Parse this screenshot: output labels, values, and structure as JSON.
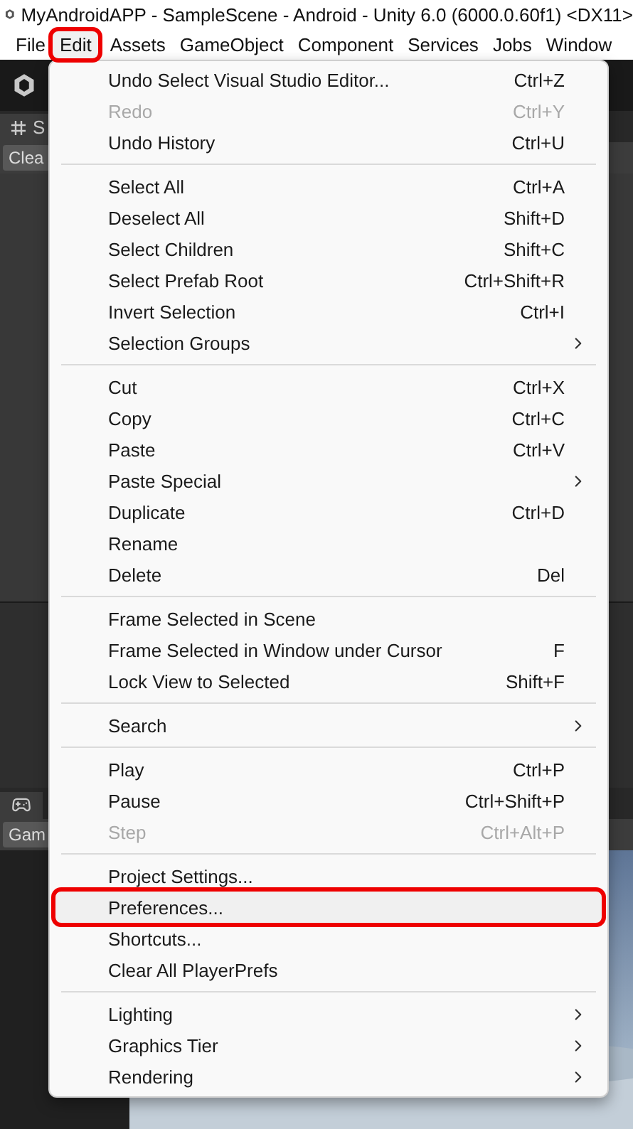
{
  "window": {
    "title": "MyAndroidAPP - SampleScene - Android - Unity 6.0 (6000.0.60f1) <DX11>"
  },
  "menubar": [
    {
      "label": "File",
      "selected": false
    },
    {
      "label": "Edit",
      "selected": true
    },
    {
      "label": "Assets",
      "selected": false
    },
    {
      "label": "GameObject",
      "selected": false
    },
    {
      "label": "Component",
      "selected": false
    },
    {
      "label": "Services",
      "selected": false
    },
    {
      "label": "Jobs",
      "selected": false
    },
    {
      "label": "Window",
      "selected": false
    }
  ],
  "editor": {
    "scene_tab": "S",
    "clear_button": "Clea",
    "game_toolbar": "Gam"
  },
  "menu": {
    "sections": [
      [
        {
          "label": "Undo Select Visual Studio Editor...",
          "shortcut": "Ctrl+Z",
          "disabled": false,
          "submenu": false,
          "selected": false
        },
        {
          "label": "Redo",
          "shortcut": "Ctrl+Y",
          "disabled": true,
          "submenu": false,
          "selected": false
        },
        {
          "label": "Undo History",
          "shortcut": "Ctrl+U",
          "disabled": false,
          "submenu": false,
          "selected": false
        }
      ],
      [
        {
          "label": "Select All",
          "shortcut": "Ctrl+A",
          "disabled": false,
          "submenu": false,
          "selected": false
        },
        {
          "label": "Deselect All",
          "shortcut": "Shift+D",
          "disabled": false,
          "submenu": false,
          "selected": false
        },
        {
          "label": "Select Children",
          "shortcut": "Shift+C",
          "disabled": false,
          "submenu": false,
          "selected": false
        },
        {
          "label": "Select Prefab Root",
          "shortcut": "Ctrl+Shift+R",
          "disabled": false,
          "submenu": false,
          "selected": false
        },
        {
          "label": "Invert Selection",
          "shortcut": "Ctrl+I",
          "disabled": false,
          "submenu": false,
          "selected": false
        },
        {
          "label": "Selection Groups",
          "disabled": false,
          "submenu": true,
          "selected": false
        }
      ],
      [
        {
          "label": "Cut",
          "shortcut": "Ctrl+X",
          "disabled": false,
          "submenu": false,
          "selected": false
        },
        {
          "label": "Copy",
          "shortcut": "Ctrl+C",
          "disabled": false,
          "submenu": false,
          "selected": false
        },
        {
          "label": "Paste",
          "shortcut": "Ctrl+V",
          "disabled": false,
          "submenu": false,
          "selected": false
        },
        {
          "label": "Paste Special",
          "disabled": false,
          "submenu": true,
          "selected": false
        },
        {
          "label": "Duplicate",
          "shortcut": "Ctrl+D",
          "disabled": false,
          "submenu": false,
          "selected": false
        },
        {
          "label": "Rename",
          "disabled": false,
          "submenu": false,
          "selected": false
        },
        {
          "label": "Delete",
          "shortcut": "Del",
          "disabled": false,
          "submenu": false,
          "selected": false
        }
      ],
      [
        {
          "label": "Frame Selected in Scene",
          "disabled": false,
          "submenu": false,
          "selected": false
        },
        {
          "label": "Frame Selected in Window under Cursor",
          "shortcut": "F",
          "disabled": false,
          "submenu": false,
          "selected": false
        },
        {
          "label": "Lock View to Selected",
          "shortcut": "Shift+F",
          "disabled": false,
          "submenu": false,
          "selected": false
        }
      ],
      [
        {
          "label": "Search",
          "disabled": false,
          "submenu": true,
          "selected": false
        }
      ],
      [
        {
          "label": "Play",
          "shortcut": "Ctrl+P",
          "disabled": false,
          "submenu": false,
          "selected": false
        },
        {
          "label": "Pause",
          "shortcut": "Ctrl+Shift+P",
          "disabled": false,
          "submenu": false,
          "selected": false
        },
        {
          "label": "Step",
          "shortcut": "Ctrl+Alt+P",
          "disabled": true,
          "submenu": false,
          "selected": false
        }
      ],
      [
        {
          "label": "Project Settings...",
          "disabled": false,
          "submenu": false,
          "selected": false
        },
        {
          "label": "Preferences...",
          "disabled": false,
          "submenu": false,
          "selected": true
        },
        {
          "label": "Shortcuts...",
          "disabled": false,
          "submenu": false,
          "selected": false
        },
        {
          "label": "Clear All PlayerPrefs",
          "disabled": false,
          "submenu": false,
          "selected": false
        }
      ],
      [
        {
          "label": "Lighting",
          "disabled": false,
          "submenu": true,
          "selected": false
        },
        {
          "label": "Graphics Tier",
          "disabled": false,
          "submenu": true,
          "selected": false
        },
        {
          "label": "Rendering",
          "disabled": false,
          "submenu": true,
          "selected": false
        }
      ]
    ]
  }
}
